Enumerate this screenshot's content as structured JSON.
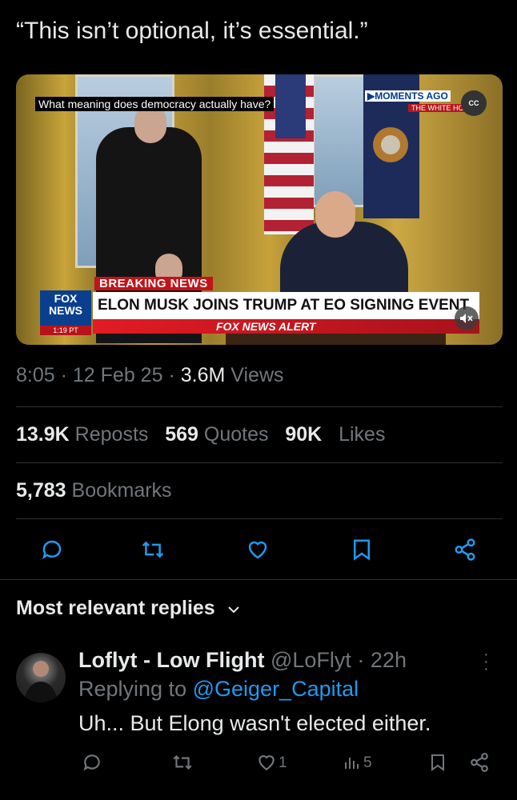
{
  "tweet": {
    "text": "“This isn’t optional, it’s essential.”",
    "video": {
      "caption": "What meaning does democracy actually have?",
      "moments_ago": "▶MOMENTS AGO",
      "white_house": "THE WHITE HO",
      "cc": "CC",
      "breaking": "BREAKING NEWS",
      "headline": "ELON MUSK JOINS TRUMP AT EO SIGNING EVENT",
      "alert": "FOX NEWS ALERT",
      "logo_line1": "FOX",
      "logo_line2": "NEWS",
      "logo_time": "1:19 PT",
      "mute_icon": "speaker-muted-icon"
    },
    "time": "8:05",
    "date": "12 Feb 25",
    "views_count": "3.6M",
    "views_label": "Views",
    "reposts_count": "13.9K",
    "reposts_label": "Reposts",
    "quotes_count": "569",
    "quotes_label": "Quotes",
    "likes_count": "90K",
    "likes_label": "Likes",
    "bookmarks_count": "5,783",
    "bookmarks_label": "Bookmarks",
    "actions": [
      "reply-icon",
      "repost-icon",
      "like-icon",
      "bookmark-icon",
      "share-icon"
    ]
  },
  "replies_header": {
    "label": "Most relevant replies",
    "icon": "chevron-down-icon"
  },
  "reply": {
    "name": "Loflyt - Low Flight",
    "handle": "@LoFlyt",
    "time": "22h",
    "replying_label": "Replying to",
    "replying_to": "@Geiger_Capital",
    "text": "Uh... But Elong wasn't elected either.",
    "likes": "1",
    "views": "5"
  },
  "colors": {
    "background": "#000000",
    "text": "#e7e9ea",
    "secondary": "#71767b",
    "link": "#1d9bf0",
    "divider": "#2f3336"
  }
}
